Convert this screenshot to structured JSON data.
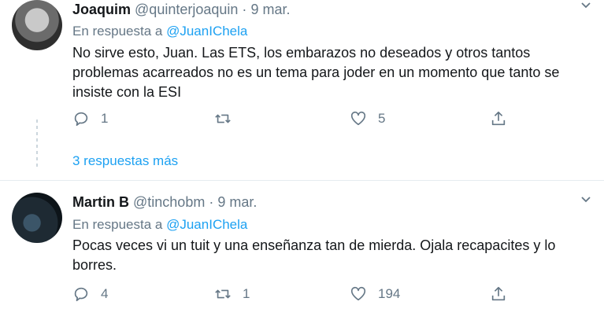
{
  "tweets": [
    {
      "name": "Joaquim",
      "handle": "@quinterjoaquin",
      "separator": "·",
      "date": "9 mar.",
      "reply_prefix": "En respuesta a",
      "reply_mention": "@JuanIChela",
      "text": "No sirve esto, Juan. Las ETS, los embarazos no deseados y otros tantos problemas acarreados no es un tema para joder en un momento que tanto se insiste con la ESI",
      "replies": "1",
      "retweets": "",
      "likes": "5",
      "icons": [
        "reply-icon",
        "retweet-icon",
        "like-icon",
        "share-icon",
        "chevron-down-icon"
      ]
    },
    {
      "name": "Martin B",
      "handle": "@tinchobm",
      "separator": "·",
      "date": "9 mar.",
      "reply_prefix": "En respuesta a",
      "reply_mention": "@JuanIChela",
      "text": "Pocas veces vi un tuit y una enseñanza tan de mierda. Ojala recapacites y lo borres.",
      "replies": "4",
      "retweets": "1",
      "likes": "194",
      "icons": [
        "reply-icon",
        "retweet-icon",
        "like-icon",
        "share-icon",
        "chevron-down-icon"
      ]
    }
  ],
  "thread": {
    "more_replies": "3 respuestas más"
  },
  "colors": {
    "link": "#1da1f2",
    "muted": "#657786",
    "text": "#14171a",
    "divider": "#e6ecf0"
  }
}
